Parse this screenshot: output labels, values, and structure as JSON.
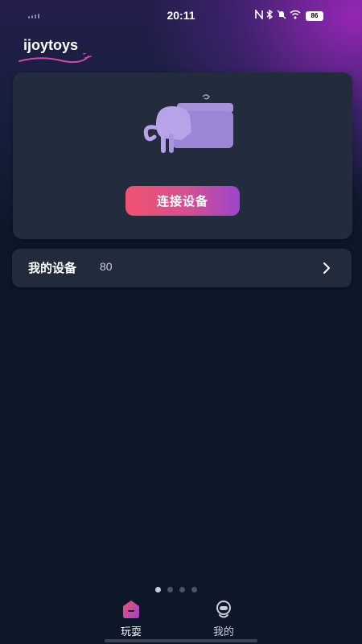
{
  "status_bar": {
    "time": "20:11",
    "battery": "86",
    "icons": [
      "nfc-icon",
      "bluetooth-icon",
      "mute-icon",
      "wifi-icon"
    ]
  },
  "app": {
    "logo_text": "ijoytoys"
  },
  "device_card": {
    "connect_label": "连接设备",
    "illustration": "cat-with-folder-illustration"
  },
  "my_devices": {
    "label": "我的设备",
    "count": "80"
  },
  "pagination": {
    "total": 4,
    "active": 1
  },
  "tab_bar": {
    "tabs": [
      {
        "label": "玩耍",
        "icon": "home-play-icon",
        "active": true
      },
      {
        "label": "我的",
        "icon": "robot-profile-icon",
        "active": false
      }
    ]
  },
  "colors": {
    "background": "#0d1728",
    "card": "#232c3d",
    "accent_start": "#f1536e",
    "accent_end": "#9a45cc"
  }
}
